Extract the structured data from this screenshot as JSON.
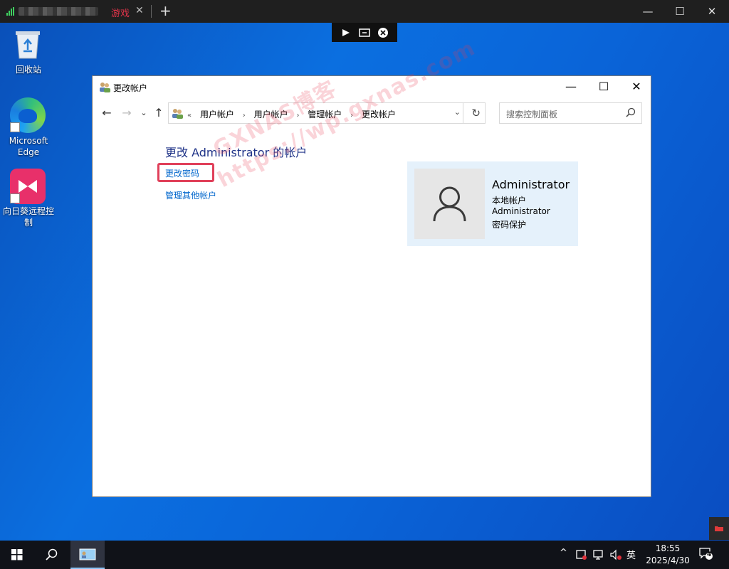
{
  "remote_bar": {
    "tab_label": "游戏",
    "tab_close": "✕",
    "new_tab": "+",
    "minimize": "—",
    "maximize": "☐",
    "close": "✕"
  },
  "desktop": {
    "icons": [
      {
        "label": "回收站"
      },
      {
        "label": "Microsoft Edge"
      },
      {
        "label": "向日葵远程控制"
      }
    ]
  },
  "window": {
    "title": "更改帐户",
    "nav": {
      "back": "←",
      "forward": "→",
      "recent": "⌄",
      "up": "↑"
    },
    "address": {
      "overflow": "«",
      "crumbs": [
        "用户帐户",
        "用户帐户",
        "管理帐户",
        "更改帐户"
      ],
      "separator": "›",
      "dropdown": "⌄",
      "refresh": "↻"
    },
    "search": {
      "placeholder": "搜索控制面板"
    },
    "heading": "更改 Administrator 的帐户",
    "links": {
      "change_password": "更改密码",
      "manage_other": "管理其他帐户"
    },
    "account": {
      "name": "Administrator",
      "type": "本地帐户",
      "username": "Administrator",
      "status": "密码保护"
    }
  },
  "watermark": {
    "line1": "GXNAS博客",
    "line2": "https://wp.gxnas.com"
  },
  "taskbar": {
    "tray_chevron": "^",
    "ime": "英",
    "time": "18:55",
    "date": "2025/4/30",
    "notification_count": "4"
  },
  "colors": {
    "accent": "#0066cc",
    "heading": "#1e3287",
    "highlight": "#e0405a",
    "card": "#e5f1fb"
  }
}
